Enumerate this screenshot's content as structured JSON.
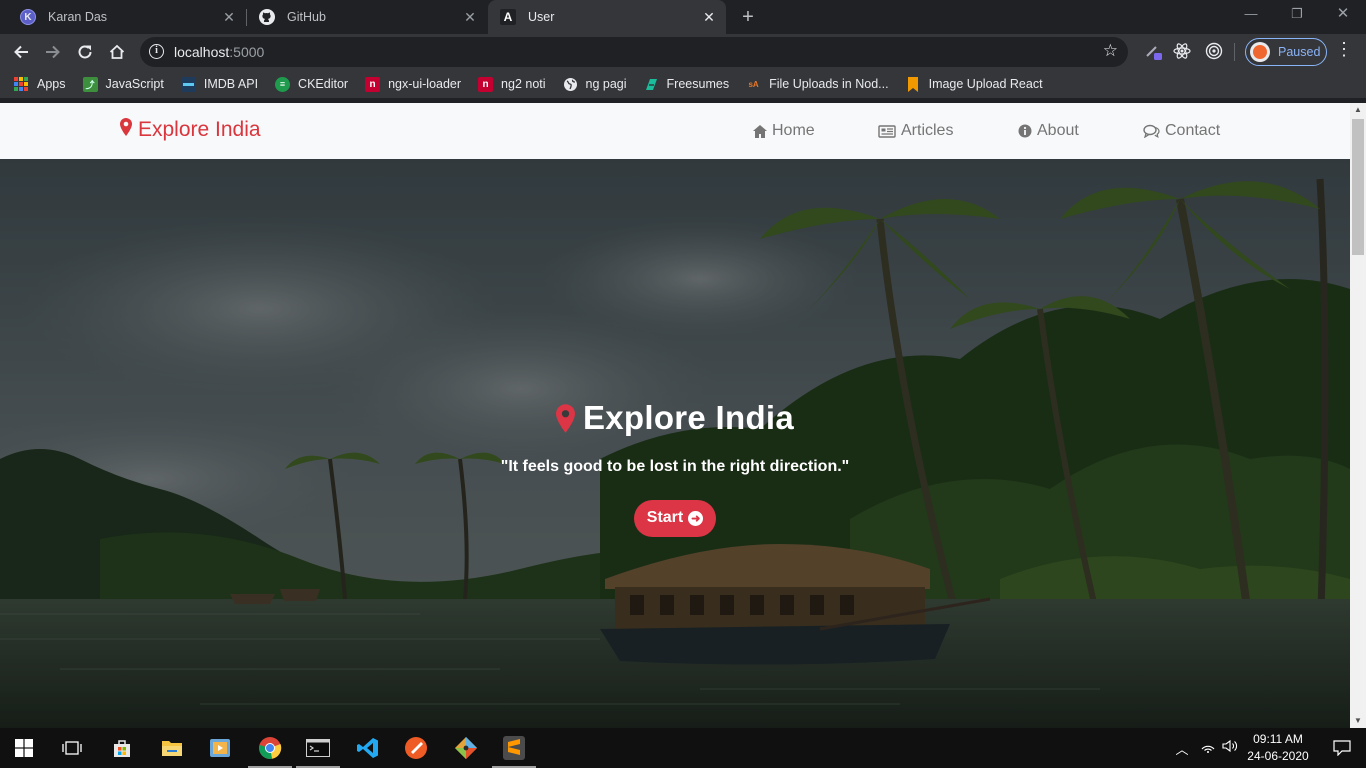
{
  "browser": {
    "tabs": [
      {
        "title": "Karan Das",
        "favicon": "karan-das-favicon",
        "favicon_letter": "K",
        "active": false
      },
      {
        "title": "GitHub",
        "favicon": "github-icon",
        "active": false
      },
      {
        "title": "User",
        "favicon": "angular-icon",
        "favicon_letter": "A",
        "active": true
      }
    ],
    "new_tab": "+",
    "window_controls": {
      "minimize": "—",
      "restore": "❐",
      "close": "✕"
    },
    "address": {
      "host": "localhost",
      "port": ":5000"
    },
    "profile_label": "Paused",
    "bookmarks": [
      {
        "label": "Apps",
        "icon": "apps-grid-icon"
      },
      {
        "label": "JavaScript",
        "icon": "javascript-favicon",
        "color": "#3d8f3d"
      },
      {
        "label": "IMDB API",
        "icon": "imdb-api-favicon",
        "color": "#1f3b5c"
      },
      {
        "label": "CKEditor",
        "icon": "ckeditor-favicon",
        "color": "#1e9b4d"
      },
      {
        "label": "ngx-ui-loader",
        "icon": "ngx-ui-loader-favicon",
        "color": "#c3002f"
      },
      {
        "label": "ng2 noti",
        "icon": "ng2-noti-favicon",
        "color": "#c3002f"
      },
      {
        "label": "ng pagi",
        "icon": "globe-icon",
        "color": "#e8eaed"
      },
      {
        "label": "Freesumes",
        "icon": "freesumes-favicon",
        "color": "#1bbc9b"
      },
      {
        "label": "File Uploads in Nod...",
        "icon": "file-uploads-favicon",
        "color": "#e97826"
      },
      {
        "label": "Image Upload React",
        "icon": "bookmark-icon",
        "color": "#f29900"
      }
    ]
  },
  "site": {
    "brand": "Explore India",
    "nav": [
      {
        "label": "Home",
        "icon": "home-icon"
      },
      {
        "label": "Articles",
        "icon": "newspaper-icon"
      },
      {
        "label": "About",
        "icon": "info-circle-icon"
      },
      {
        "label": "Contact",
        "icon": "comments-icon"
      }
    ],
    "hero": {
      "title": "Explore India",
      "quote": "\"It feels good to be lost in the right direction.\"",
      "button": "Start"
    },
    "accent_color": "#dc3545"
  },
  "taskbar": {
    "apps": [
      {
        "name": "start-button",
        "icon": "windows-logo-icon"
      },
      {
        "name": "task-view",
        "icon": "task-view-icon"
      },
      {
        "name": "microsoft-store",
        "icon": "store-icon"
      },
      {
        "name": "file-explorer",
        "icon": "folder-icon"
      },
      {
        "name": "media-player",
        "icon": "video-icon"
      },
      {
        "name": "chrome",
        "icon": "chrome-icon"
      },
      {
        "name": "terminal",
        "icon": "terminal-icon"
      },
      {
        "name": "vs-code",
        "icon": "vscode-icon"
      },
      {
        "name": "postman",
        "icon": "postman-icon"
      },
      {
        "name": "git",
        "icon": "git-icon"
      },
      {
        "name": "sublime-text",
        "icon": "sublime-icon"
      }
    ],
    "time": "09:11 AM",
    "date": "24-06-2020"
  }
}
